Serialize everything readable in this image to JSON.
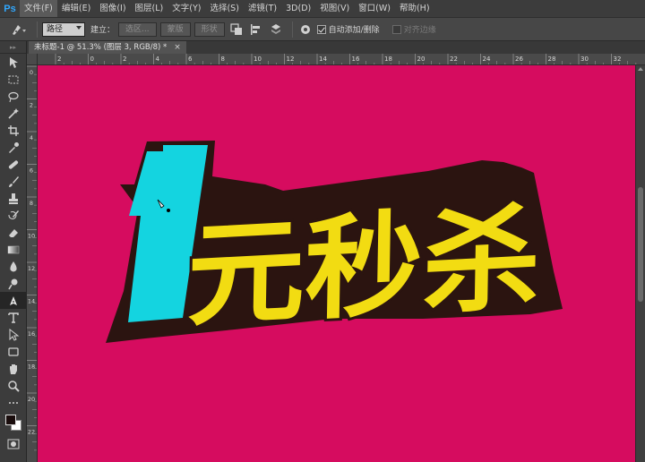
{
  "app": {
    "logo": "Ps"
  },
  "menu": [
    {
      "label": "文件(F)",
      "active": true
    },
    {
      "label": "编辑(E)"
    },
    {
      "label": "图像(I)"
    },
    {
      "label": "图层(L)"
    },
    {
      "label": "文字(Y)"
    },
    {
      "label": "选择(S)"
    },
    {
      "label": "滤镜(T)"
    },
    {
      "label": "3D(D)"
    },
    {
      "label": "视图(V)"
    },
    {
      "label": "窗口(W)"
    },
    {
      "label": "帮助(H)"
    }
  ],
  "options": {
    "mode_select": "路径",
    "build_label": "建立：",
    "selection_btn": "选区...",
    "mask_btn": "蒙版",
    "shape_btn": "形状",
    "auto_add_label": "自动添加/删除",
    "auto_add_checked": true,
    "align_edges_label": "对齐边缘",
    "align_edges_checked": false
  },
  "document": {
    "tab_title": "未标题-1 @ 51.3% (图层 3, RGB/8) *",
    "close_glyph": "×"
  },
  "ruler": {
    "top_labels": [
      "2",
      "0",
      "2",
      "4",
      "6",
      "8",
      "10",
      "12",
      "14",
      "16",
      "18",
      "20",
      "22",
      "24",
      "26",
      "28",
      "30",
      "32"
    ],
    "left_labels": [
      "0",
      "2",
      "4",
      "6",
      "8",
      "10",
      "12",
      "14",
      "16",
      "18",
      "20",
      "22"
    ]
  },
  "artwork": {
    "headline": "元秒杀",
    "numeral": "1",
    "colors": {
      "canvas": "#d60c5f",
      "outline": "#2b1410",
      "numeral": "#14d4e0",
      "text": "#f2dc12"
    }
  },
  "colors": {
    "foreground": "#1a0d0d",
    "background": "#ffffff"
  }
}
